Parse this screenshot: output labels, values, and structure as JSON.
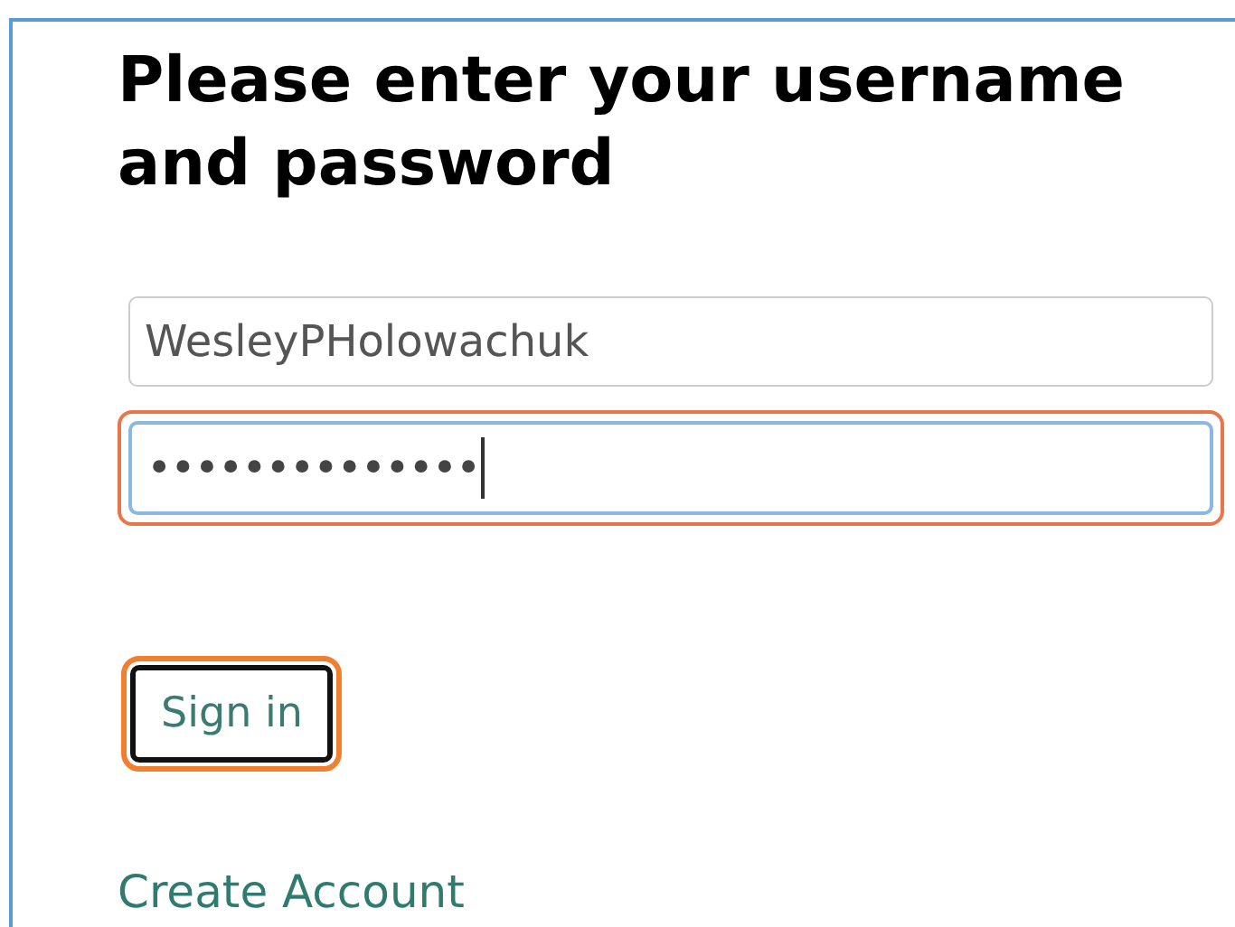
{
  "heading": "Please enter your username and password",
  "fields": [
    {
      "kind": "text",
      "value": "WesleyPHolowachuk",
      "focused": false,
      "highlighted": false
    },
    {
      "kind": "password",
      "value": "••••••••••••••",
      "focused": true,
      "highlighted": true
    }
  ],
  "sign_in_button": {
    "label": "Sign in",
    "highlighted": true
  },
  "create_account_link": "Create Account"
}
